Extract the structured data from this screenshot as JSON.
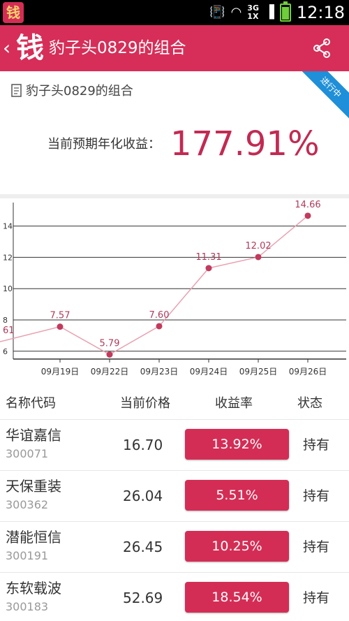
{
  "status_bar": {
    "time": "12:18",
    "network_top": "3G",
    "network_bottom": "1X",
    "app_icon_glyph": "钱"
  },
  "app_bar": {
    "logo_glyph": "钱",
    "title": "豹子头0829的组合",
    "color": "#d62e58"
  },
  "header": {
    "portfolio_name": "豹子头0829的组合",
    "ribbon": "进行中",
    "yield_label": "当前预期年化收益：",
    "yield_value": "177.91%"
  },
  "chart_data": {
    "type": "line",
    "categories": [
      "",
      "09月19日",
      "09月22日",
      "09月23日",
      "09月24日",
      "09月25日",
      "09月26日"
    ],
    "values": [
      6.61,
      7.57,
      5.79,
      7.6,
      11.31,
      12.02,
      14.66
    ],
    "point_labels": [
      "61",
      "7.57",
      "5.79",
      "7.60",
      "11.31",
      "12.02",
      "14.66"
    ],
    "ylim": [
      5.5,
      15.5
    ],
    "yticks": [
      6,
      8,
      10,
      12,
      14
    ],
    "grid": true,
    "line_color": "#e9a0b0",
    "point_color": "#c23a5c",
    "label_color": "#b03a5a"
  },
  "table": {
    "headers": {
      "name": "名称代码",
      "price": "当前价格",
      "yield": "收益率",
      "status": "状态"
    },
    "rows": [
      {
        "name": "华谊嘉信",
        "code": "300071",
        "price": "16.70",
        "yield": "13.92%",
        "status": "持有"
      },
      {
        "name": "天保重装",
        "code": "300362",
        "price": "26.04",
        "yield": "5.51%",
        "status": "持有"
      },
      {
        "name": "潜能恒信",
        "code": "300191",
        "price": "26.45",
        "yield": "10.25%",
        "status": "持有"
      },
      {
        "name": "东软载波",
        "code": "300183",
        "price": "52.69",
        "yield": "18.54%",
        "status": "持有"
      }
    ]
  }
}
